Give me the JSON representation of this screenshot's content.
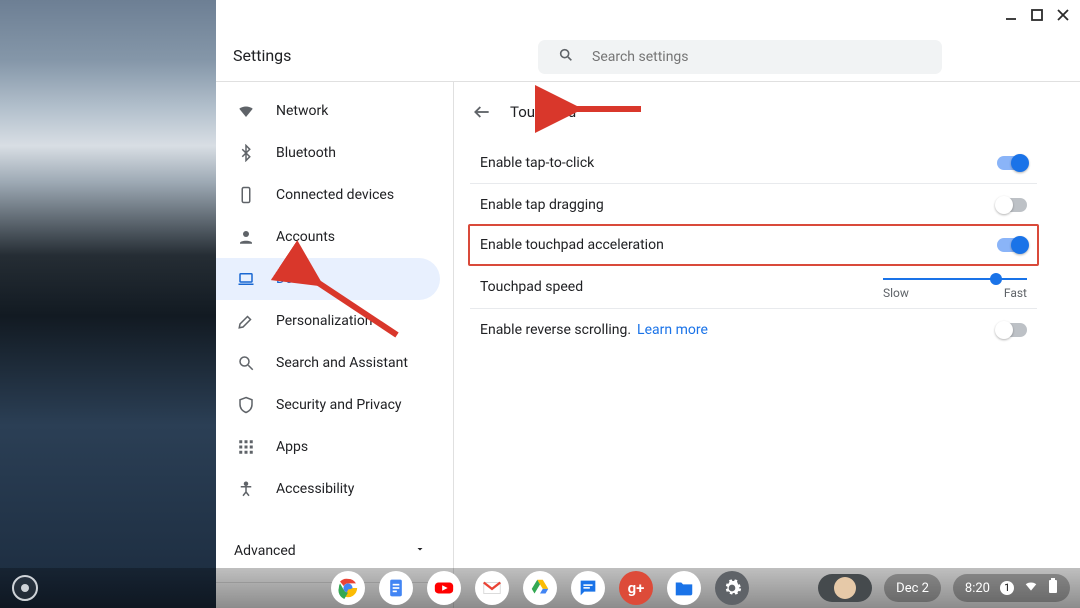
{
  "app_title": "Settings",
  "search": {
    "placeholder": "Search settings"
  },
  "sidebar": {
    "items": [
      {
        "label": "Network",
        "icon": "wifi-icon"
      },
      {
        "label": "Bluetooth",
        "icon": "bluetooth-icon"
      },
      {
        "label": "Connected devices",
        "icon": "phone-icon"
      },
      {
        "label": "Accounts",
        "icon": "person-icon"
      },
      {
        "label": "Device",
        "icon": "laptop-icon"
      },
      {
        "label": "Personalization",
        "icon": "brush-icon"
      },
      {
        "label": "Search and Assistant",
        "icon": "search-icon"
      },
      {
        "label": "Security and Privacy",
        "icon": "shield-icon"
      },
      {
        "label": "Apps",
        "icon": "apps-icon"
      },
      {
        "label": "Accessibility",
        "icon": "accessibility-icon"
      }
    ],
    "active_index": 4,
    "advanced_label": "Advanced"
  },
  "page": {
    "title": "Touchpad",
    "rows": {
      "tap_to_click": {
        "label": "Enable tap-to-click",
        "on": true
      },
      "tap_dragging": {
        "label": "Enable tap dragging",
        "on": false
      },
      "accel": {
        "label": "Enable touchpad acceleration",
        "on": true,
        "highlighted": true
      },
      "speed": {
        "label": "Touchpad speed",
        "min_label": "Slow",
        "max_label": "Fast",
        "value": 0.74
      },
      "reverse": {
        "label": "Enable reverse scrolling.",
        "link_text": "Learn more",
        "on": false
      }
    }
  },
  "shelf": {
    "apps": [
      "chrome",
      "docs",
      "youtube",
      "gmail",
      "drive",
      "messages",
      "google-plus",
      "files",
      "settings"
    ],
    "date": "Dec 2",
    "time": "8:20",
    "notification_count": "1"
  }
}
